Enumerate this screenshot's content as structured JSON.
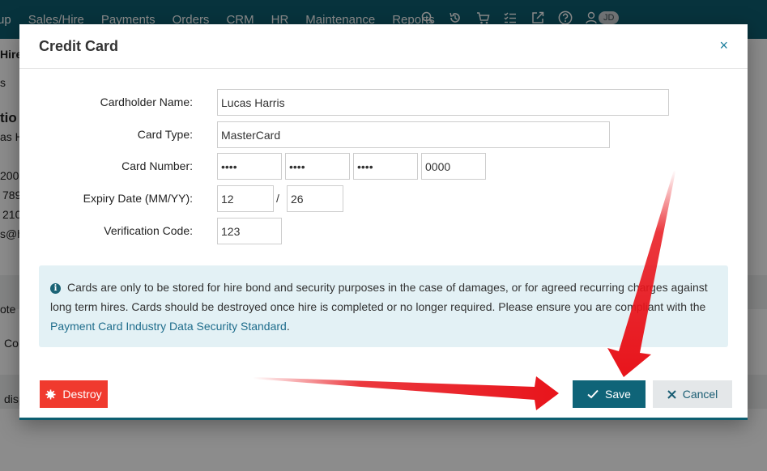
{
  "nav": {
    "items": [
      "up",
      "Sales/Hire",
      "Payments",
      "Orders",
      "CRM",
      "HR",
      "Maintenance",
      "Reports"
    ],
    "avatar": "JD"
  },
  "background": {
    "hire": "Hire",
    "s": "s",
    "tio": "tio",
    "as": "as H",
    "n1": "200",
    "n2": "789",
    "n3": "210",
    "email": "s@h",
    "note": "ote",
    "co": "Co",
    "disp": "disp"
  },
  "modal": {
    "title": "Credit Card",
    "close": "×",
    "form": {
      "cardholder_label": "Cardholder Name:",
      "cardholder_value": "Lucas Harris",
      "card_type_label": "Card Type:",
      "card_type_value": "MasterCard",
      "card_number_label": "Card Number:",
      "card_number_1": "••••",
      "card_number_2": "••••",
      "card_number_3": "••••",
      "card_number_4": "0000",
      "expiry_label": "Expiry Date (MM/YY):",
      "expiry_month": "12",
      "expiry_sep": "/",
      "expiry_year": "26",
      "cvv_label": "Verification Code:",
      "cvv_value": "123"
    },
    "info": {
      "text": "Cards are only to be stored for hire bond and security purposes in the case of damages, or for agreed recurring charges against long term hires.  Cards should be destroyed once hire is completed or no longer required.  Please ensure you are compliant with the ",
      "link": "Payment Card Industry Data Security Standard",
      "suffix": "."
    },
    "buttons": {
      "destroy": "Destroy",
      "save": "Save",
      "cancel": "Cancel"
    }
  },
  "colors": {
    "nav_bg": "#0d5e70",
    "save_bg": "#0f6478",
    "destroy_bg": "#f03a2e",
    "info_bg": "#e3f1f5",
    "arrow": "#e8141b"
  }
}
